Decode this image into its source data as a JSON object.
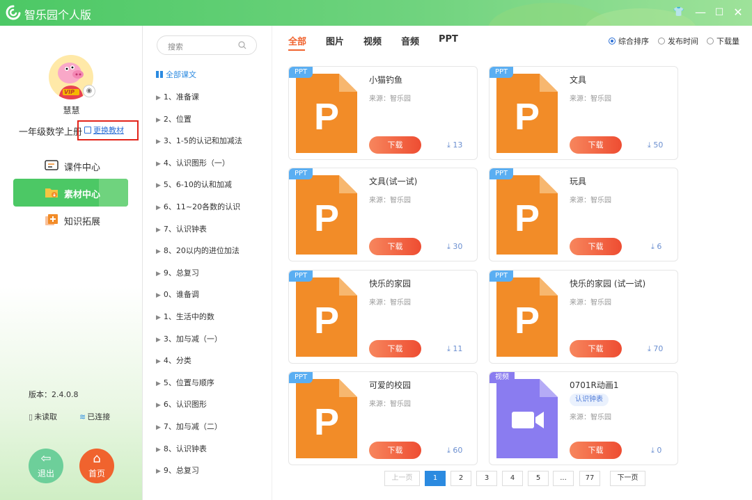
{
  "app": {
    "title": "智乐园个人版",
    "logo_icon": "app-logo-icon"
  },
  "window_controls": {
    "skin_icon": "skin-icon",
    "minimize_icon": "minimize-icon",
    "maximize_icon": "maximize-icon",
    "close_icon": "close-icon"
  },
  "user": {
    "name": "慧慧",
    "badge": "VIP",
    "grade": "一年级数学上册",
    "change_label": "更换教材"
  },
  "nav": [
    {
      "label": "课件中心",
      "icon": "courseware-icon",
      "active": false
    },
    {
      "label": "素材中心",
      "icon": "folder-download-icon",
      "active": true
    },
    {
      "label": "知识拓展",
      "icon": "knowledge-plus-icon",
      "active": false
    }
  ],
  "footer": {
    "version": "版本：2.4.0.8",
    "unread": "未读取",
    "connected": "已连接",
    "exit_label": "退出",
    "home_label": "首页"
  },
  "colors": {
    "brand_green": "#4cc865",
    "accent_orange": "#f0632e",
    "ppt_orange": "#f28c28",
    "video_purple": "#8a7cf0",
    "link_blue": "#2b8ae0"
  },
  "tree": {
    "search_placeholder": "搜索",
    "all_label": "全部课文",
    "items": [
      "1、准备课",
      "2、位置",
      "3、1-5的认记和加减法",
      "4、认识图形（一）",
      "5、6-10的认和加减",
      "6、11~20各数的认识",
      "7、认识钟表",
      "8、20以内的进位加法",
      "9、总复习",
      "0、谁备调",
      "1、生活中的数",
      "3、加与减（一）",
      "4、分类",
      "5、位置与顺序",
      "6、认识图形",
      "7、加与减（二）",
      "8、认识钟表",
      "9、总复习"
    ]
  },
  "tabs": [
    "全部",
    "图片",
    "视频",
    "音频",
    "PPT"
  ],
  "sort": [
    {
      "label": "综合排序",
      "selected": true
    },
    {
      "label": "发布时间",
      "selected": false
    },
    {
      "label": "下载量",
      "selected": false
    }
  ],
  "cards": [
    {
      "tag": "PPT",
      "type": "ppt",
      "title": "小猫钓鱼",
      "source": "来源：智乐园",
      "download": "下载",
      "count": "13"
    },
    {
      "tag": "PPT",
      "type": "ppt",
      "title": "文具",
      "source": "来源：智乐园",
      "download": "下载",
      "count": "50"
    },
    {
      "tag": "PPT",
      "type": "ppt",
      "title": "文具(试一试)",
      "source": "来源：智乐园",
      "download": "下载",
      "count": "30"
    },
    {
      "tag": "PPT",
      "type": "ppt",
      "title": "玩具",
      "source": "来源：智乐园",
      "download": "下载",
      "count": "6"
    },
    {
      "tag": "PPT",
      "type": "ppt",
      "title": "快乐的家园",
      "source": "来源：智乐园",
      "download": "下载",
      "count": "11"
    },
    {
      "tag": "PPT",
      "type": "ppt",
      "title": "快乐的家园 (试一试)",
      "source": "来源：智乐园",
      "download": "下载",
      "count": "70"
    },
    {
      "tag": "PPT",
      "type": "ppt",
      "title": "可爱的校园",
      "source": "来源：智乐园",
      "download": "下载",
      "count": "60"
    },
    {
      "tag": "视频",
      "type": "video",
      "title": "0701R动画1",
      "badge": "认识钟表",
      "source": "来源：智乐园",
      "download": "下载",
      "count": "0"
    }
  ],
  "pagination": {
    "prev": "上一页",
    "pages": [
      "1",
      "2",
      "3",
      "4",
      "5",
      "...",
      "77"
    ],
    "current": "1",
    "next": "下一页"
  }
}
